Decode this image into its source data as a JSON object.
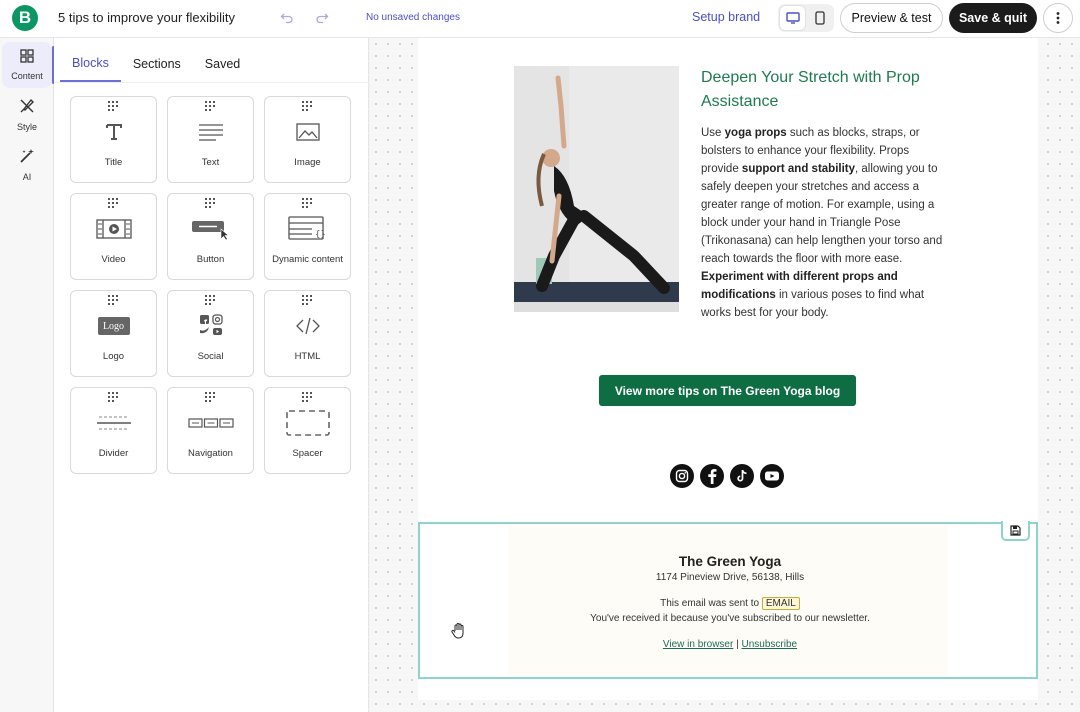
{
  "topbar": {
    "logo_letter": "B",
    "title": "5 tips to improve your flexibility",
    "save_status": "No unsaved changes",
    "setup_brand": "Setup brand",
    "preview_label": "Preview & test",
    "save_label": "Save & quit",
    "accent": "#0b9663"
  },
  "rail": {
    "items": [
      {
        "label": "Content",
        "icon": "grid-icon"
      },
      {
        "label": "Style",
        "icon": "brush-icon"
      },
      {
        "label": "AI",
        "icon": "magic-wand-icon"
      }
    ]
  },
  "panel": {
    "tabs": [
      {
        "label": "Blocks"
      },
      {
        "label": "Sections"
      },
      {
        "label": "Saved"
      }
    ],
    "blocks": [
      {
        "label": "Title",
        "icon": "title-icon"
      },
      {
        "label": "Text",
        "icon": "text-icon"
      },
      {
        "label": "Image",
        "icon": "image-icon"
      },
      {
        "label": "Video",
        "icon": "video-icon"
      },
      {
        "label": "Button",
        "icon": "button-icon"
      },
      {
        "label": "Dynamic content",
        "icon": "dynamic-content-icon"
      },
      {
        "label": "Logo",
        "icon": "logo-icon",
        "icon_text": "Logo"
      },
      {
        "label": "Social",
        "icon": "social-icon"
      },
      {
        "label": "HTML",
        "icon": "html-icon"
      },
      {
        "label": "Divider",
        "icon": "divider-icon"
      },
      {
        "label": "Navigation",
        "icon": "navigation-icon"
      },
      {
        "label": "Spacer",
        "icon": "spacer-icon"
      }
    ]
  },
  "email": {
    "heading": "Deepen Your Stretch with Prop Assistance",
    "body": {
      "p1": "Use ",
      "b1": "yoga props",
      "p2": " such as blocks, straps, or bolsters to enhance your flexibility. Props provide ",
      "b2": "support and stability",
      "p3": ", allowing you to safely deepen your stretches and access a greater range of motion. For example, using a block under your hand in Triangle Pose (Trikonasana) can help lengthen your torso and reach towards the floor with more ease. ",
      "b3": "Experiment with different props and modifications",
      "p4": " in various poses to find what works best for your body."
    },
    "cta_label": "View more tips on The Green Yoga blog",
    "cta_color": "#0f6d44",
    "socials": [
      "instagram-icon",
      "facebook-icon",
      "tiktok-icon",
      "youtube-icon"
    ],
    "footer": {
      "company": "The Green Yoga",
      "address": "1174 Pineview Drive, 56138, Hills",
      "sent_to_prefix": "This email was sent to",
      "email_tag": "EMAIL",
      "reason": "You've received it because you've subscribed to our newsletter.",
      "view_in_browser": "View in browser",
      "separator": "|",
      "unsubscribe": "Unsubscribe"
    }
  }
}
